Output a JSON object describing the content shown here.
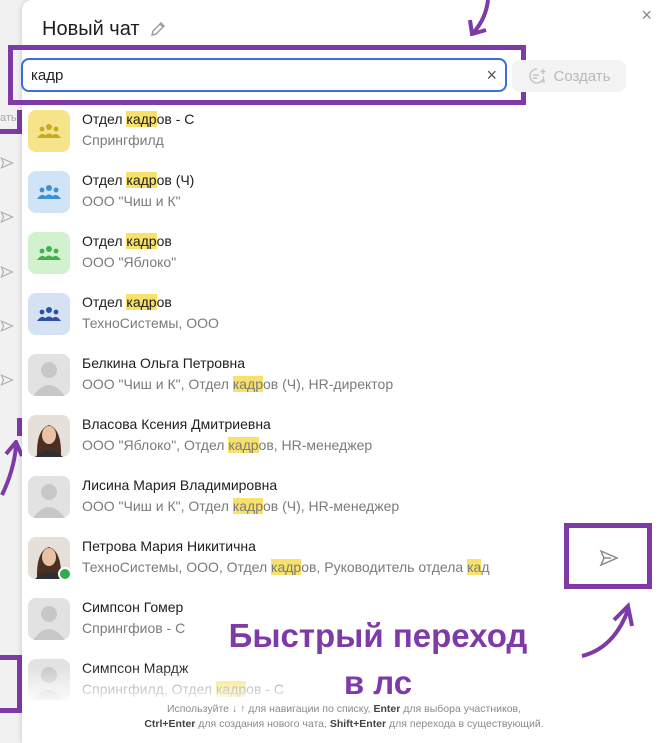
{
  "dialog": {
    "title": "Новый чат",
    "close_label": "×"
  },
  "search": {
    "value": "кадр",
    "clear_label": "×"
  },
  "create_button": {
    "label": "Создать"
  },
  "background": {
    "fragment": "ать"
  },
  "results": [
    {
      "type": "group",
      "color": "#f6e48b",
      "icon_color": "#c9a922",
      "name": [
        "Отдел ",
        "кадр",
        "ов - С"
      ],
      "sub": [
        "Спрингфилд"
      ]
    },
    {
      "type": "group",
      "color": "#cfe4f6",
      "icon_color": "#3f8fd1",
      "name": [
        "Отдел ",
        "кадр",
        "ов (Ч)"
      ],
      "sub": [
        "ООО \"Чиш и К\""
      ]
    },
    {
      "type": "group",
      "color": "#d2f1cf",
      "icon_color": "#3fb24a",
      "name": [
        "Отдел ",
        "кадр",
        "ов"
      ],
      "sub": [
        "ООО \"Яблоко\""
      ]
    },
    {
      "type": "group",
      "color": "#d6e1f4",
      "icon_color": "#2a4fa6",
      "name": [
        "Отдел ",
        "кадр",
        "ов"
      ],
      "sub": [
        "ТехноСистемы, ООО"
      ]
    },
    {
      "type": "person",
      "name": [
        "Белкина Ольга Петровна"
      ],
      "sub": [
        "ООО \"Чиш и К\", Отдел ",
        "кадр",
        "ов (Ч), HR-директор"
      ]
    },
    {
      "type": "photo-female",
      "name": [
        "Власова Ксения Дмитриевна"
      ],
      "sub": [
        "ООО \"Яблоко\", Отдел ",
        "кадр",
        "ов, HR-менеджер"
      ]
    },
    {
      "type": "person",
      "name": [
        "Лисина Мария Владимировна"
      ],
      "sub": [
        "ООО \"Чиш и К\", Отдел ",
        "кадр",
        "ов (Ч), HR-менеджер"
      ]
    },
    {
      "type": "photo-female-online",
      "name": [
        "Петрова Мария Никитична"
      ],
      "sub": [
        "ТехноСистемы, ООО, Отдел ",
        "кадр",
        "ов, Руководитель отдела ",
        "ка",
        "д"
      ]
    },
    {
      "type": "person",
      "name": [
        "Симпсон Гомер"
      ],
      "sub": [
        "Спрингфи",
        "",
        "ов - С"
      ]
    },
    {
      "type": "person",
      "name": [
        "Симпсон Мардж"
      ],
      "sub": [
        "Спрингфилд, Отдел ",
        "кадр",
        "ов - С"
      ]
    }
  ],
  "annotation": {
    "line1": "Быстрый переход",
    "line2": "в лс",
    "color": "#7e3aa7"
  },
  "footer": {
    "line1_parts": [
      "Используйте ↓ ↑ для навигации по списку, ",
      "Enter",
      " для выбора участников,"
    ],
    "line2_parts": [
      "Ctrl+Enter",
      " для создания нового чата, ",
      "Shift+Enter",
      " для перехода в существующий."
    ]
  }
}
